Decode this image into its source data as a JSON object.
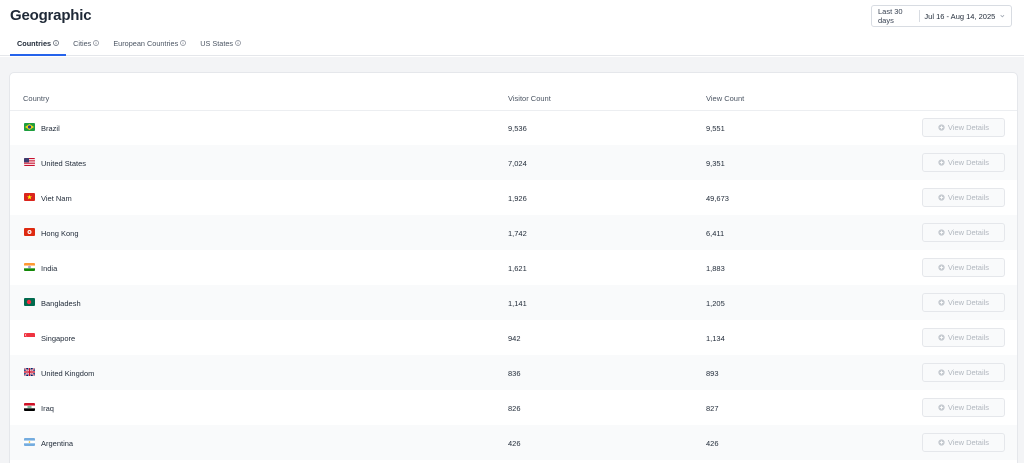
{
  "page": {
    "title": "Geographic"
  },
  "date_filter": {
    "preset": "Last 30 days",
    "range": "Jul 16 - Aug 14, 2025"
  },
  "tabs": [
    {
      "label": "Countries",
      "active": true
    },
    {
      "label": "Cities",
      "active": false
    },
    {
      "label": "European Countries",
      "active": false
    },
    {
      "label": "US States",
      "active": false
    }
  ],
  "table": {
    "columns": [
      "Country",
      "Visitor Count",
      "View Count"
    ],
    "action_label": "View Details",
    "rows": [
      {
        "country": "Brazil",
        "flag": "brazil-flag-icon",
        "visitors": "9,536",
        "views": "9,551"
      },
      {
        "country": "United States",
        "flag": "united-states-flag-icon",
        "visitors": "7,024",
        "views": "9,351"
      },
      {
        "country": "Viet Nam",
        "flag": "viet-nam-flag-icon",
        "visitors": "1,926",
        "views": "49,673"
      },
      {
        "country": "Hong Kong",
        "flag": "hong-kong-flag-icon",
        "visitors": "1,742",
        "views": "6,411"
      },
      {
        "country": "India",
        "flag": "india-flag-icon",
        "visitors": "1,621",
        "views": "1,883"
      },
      {
        "country": "Bangladesh",
        "flag": "bangladesh-flag-icon",
        "visitors": "1,141",
        "views": "1,205"
      },
      {
        "country": "Singapore",
        "flag": "singapore-flag-icon",
        "visitors": "942",
        "views": "1,134"
      },
      {
        "country": "United Kingdom",
        "flag": "united-kingdom-flag-icon",
        "visitors": "836",
        "views": "893"
      },
      {
        "country": "Iraq",
        "flag": "iraq-flag-icon",
        "visitors": "826",
        "views": "827"
      },
      {
        "country": "Argentina",
        "flag": "argentina-flag-icon",
        "visitors": "426",
        "views": "426"
      }
    ]
  },
  "colors": {
    "accent": "#2563eb",
    "page_background": "#f3f4f6",
    "alt_row": "#f9fafb"
  }
}
